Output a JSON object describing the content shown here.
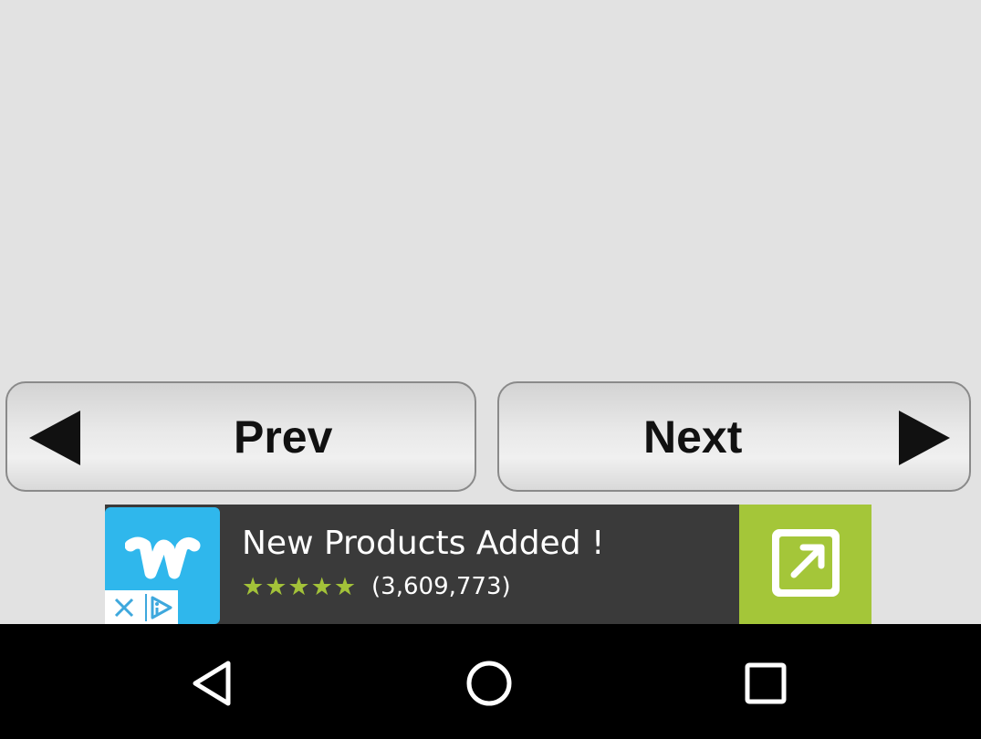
{
  "buttons": {
    "prev_label": "Prev",
    "next_label": "Next"
  },
  "ad": {
    "logo_letter": "w",
    "title": "New Products Added !",
    "rating_stars": "★★★★★",
    "rating_value": 4.5,
    "rating_count": "(3,609,773)",
    "colors": {
      "logo_bg": "#2fb7ec",
      "action_bg": "#a4c639",
      "star": "#a3c239",
      "banner_bg": "#3a3a3a"
    },
    "icons": [
      "close-icon",
      "adchoices-icon",
      "open-external-icon"
    ]
  },
  "system_nav": {
    "icons": [
      "back-icon",
      "home-icon",
      "recent-apps-icon"
    ]
  }
}
